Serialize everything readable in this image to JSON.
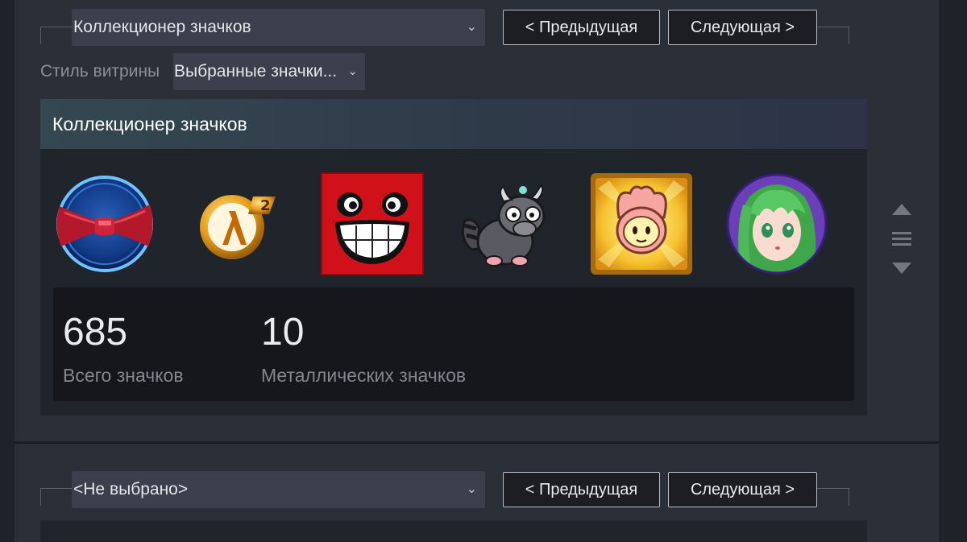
{
  "section1": {
    "selected": "Коллекционер значков",
    "prev_label": "< Предыдущая",
    "next_label": "Следующая >",
    "style_label": "Стиль витрины",
    "style_value": "Выбранные значки...",
    "showcase_title": "Коллекционер значков",
    "badges": [
      {
        "icon": "bowtie-badge-icon"
      },
      {
        "icon": "half-life-2-badge-icon"
      },
      {
        "icon": "super-meat-boy-badge-icon"
      },
      {
        "icon": "raccoon-creature-badge-icon"
      },
      {
        "icon": "scribblenauts-badge-icon"
      },
      {
        "icon": "anime-girl-badge-icon"
      }
    ],
    "stats": {
      "total_value": "685",
      "total_label": "Всего значков",
      "foil_value": "10",
      "foil_label": "Металлических значков"
    }
  },
  "section2": {
    "selected": "<Не выбрано>",
    "prev_label": "< Предыдущая",
    "next_label": "Следующая >"
  },
  "colors": {
    "panel": "#2b2f38",
    "page_bg": "#1f2229",
    "select_bg": "#3b404c",
    "button_bg": "#1c1e24",
    "stats_bg": "#15171c"
  }
}
